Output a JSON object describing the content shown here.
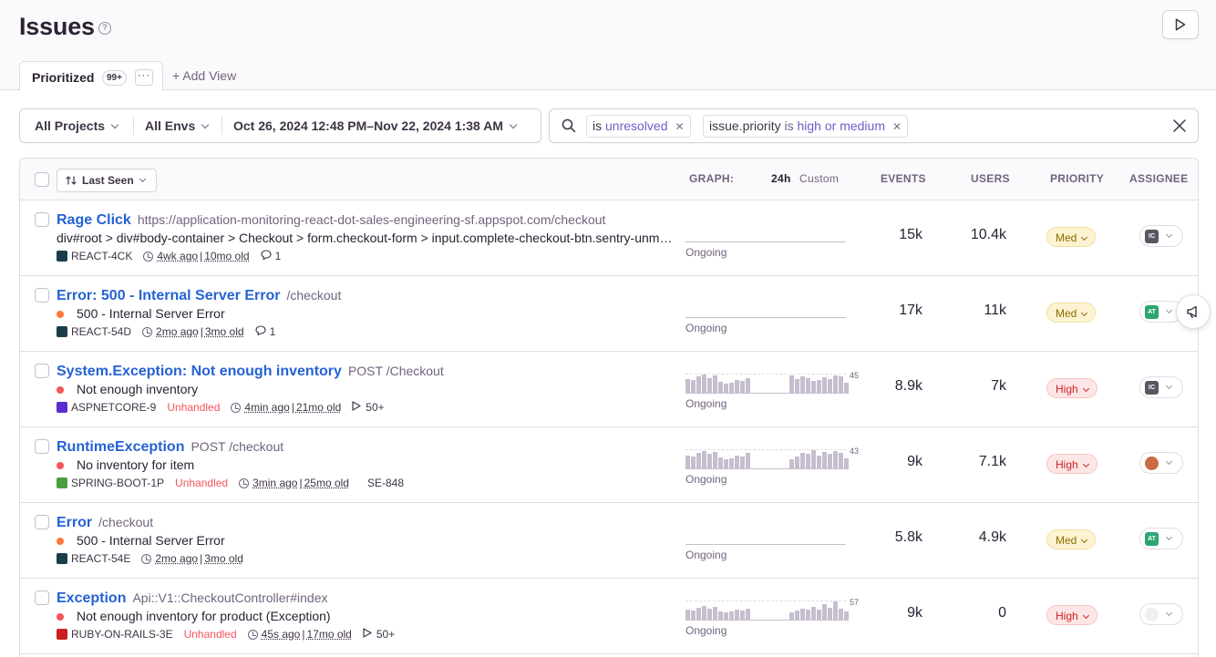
{
  "header": {
    "title": "Issues"
  },
  "tabs": {
    "active_label": "Prioritized",
    "active_badge": "99+",
    "more": "···",
    "add_view": "+ Add View"
  },
  "filters": {
    "projects": "All Projects",
    "envs": "All Envs",
    "date_range": "Oct 26, 2024 12:48 PM–Nov 22, 2024 1:38 AM"
  },
  "search": {
    "tokens": [
      {
        "key": "is",
        "op": "",
        "value": "unresolved"
      },
      {
        "key": "issue.priority",
        "op": "is",
        "value": "high or medium"
      }
    ]
  },
  "table": {
    "sort_label": "Last Seen",
    "headers": {
      "graph": "GRAPH:",
      "period_24h": "24h",
      "period_custom": "Custom",
      "events": "EVENTS",
      "users": "USERS",
      "priority": "PRIORITY",
      "assignee": "ASSIGNEE"
    },
    "rows": [
      {
        "title": "Rage Click",
        "location": "https://application-monitoring-react-dot-sales-engineering-sf.appspot.com/checkout",
        "message": "div#root > div#body-container > Checkout > form.checkout-form > input.complete-checkout-btn.sentry-unmask",
        "project": "REACT-4CK",
        "unhandled": "",
        "last_seen": "4wk ago",
        "age": "10mo old",
        "extra": "1",
        "status": "Ongoing",
        "events": "15k",
        "users": "10.4k",
        "priority": "Med",
        "assignee": "IC",
        "graph_max": "",
        "bars": []
      },
      {
        "title": "Error: 500 - Internal Server Error",
        "location": "/checkout",
        "message": "500 - Internal Server Error",
        "project": "REACT-54D",
        "unhandled": "",
        "last_seen": "2mo ago",
        "age": "3mo old",
        "extra": "1",
        "status": "Ongoing",
        "events": "17k",
        "users": "11k",
        "priority": "Med",
        "assignee": "AT",
        "graph_max": "",
        "bars": []
      },
      {
        "title": "System.Exception: Not enough inventory",
        "location": "POST /Checkout",
        "message": "Not enough inventory",
        "project": "ASPNETCORE-9",
        "unhandled": "Unhandled",
        "last_seen": "4min ago",
        "age": "21mo old",
        "extra": "50+",
        "status": "Ongoing",
        "events": "8.9k",
        "users": "7k",
        "priority": "High",
        "assignee": "IC",
        "graph_max": "45",
        "bars": [
          16,
          15,
          19,
          21,
          17,
          20,
          13,
          11,
          12,
          15,
          14,
          17,
          0,
          0,
          0,
          0,
          0,
          0,
          0,
          20,
          16,
          19,
          17,
          14,
          15,
          18,
          16,
          20,
          19,
          12
        ]
      },
      {
        "title": "RuntimeException",
        "location": "POST /checkout",
        "message": "No inventory for item",
        "project": "SPRING-BOOT-1P",
        "unhandled": "Unhandled",
        "last_seen": "3min ago",
        "age": "25mo old",
        "extra": "SE-848",
        "status": "Ongoing",
        "events": "9k",
        "users": "7.1k",
        "priority": "High",
        "assignee": "",
        "graph_max": "43",
        "bars": [
          14,
          13,
          16,
          18,
          15,
          17,
          12,
          10,
          11,
          14,
          13,
          16,
          0,
          0,
          0,
          0,
          0,
          0,
          0,
          10,
          13,
          16,
          15,
          19,
          14,
          17,
          15,
          18,
          16,
          11
        ]
      },
      {
        "title": "Error",
        "location": "/checkout",
        "message": "500 - Internal Server Error",
        "project": "REACT-54E",
        "unhandled": "",
        "last_seen": "2mo ago",
        "age": "3mo old",
        "extra": "",
        "status": "Ongoing",
        "events": "5.8k",
        "users": "4.9k",
        "priority": "Med",
        "assignee": "AT",
        "graph_max": "",
        "bars": []
      },
      {
        "title": "Exception",
        "location": "Api::V1::CheckoutController#index",
        "message": "Not enough inventory for product (Exception)",
        "project": "RUBY-ON-RAILS-3E",
        "unhandled": "Unhandled",
        "last_seen": "45s ago",
        "age": "17mo old",
        "extra": "50+",
        "status": "Ongoing",
        "events": "9k",
        "users": "0",
        "priority": "High",
        "assignee": "",
        "graph_max": "57",
        "bars": [
          12,
          11,
          14,
          16,
          13,
          15,
          10,
          9,
          10,
          12,
          11,
          13,
          0,
          0,
          0,
          0,
          0,
          0,
          0,
          9,
          11,
          13,
          12,
          15,
          12,
          18,
          14,
          21,
          13,
          10
        ]
      }
    ]
  },
  "colors": {
    "link": "#2562d4",
    "unhandled": "#f55459",
    "med_bg": "#fdf3d0",
    "high_bg": "#fde6e6"
  }
}
